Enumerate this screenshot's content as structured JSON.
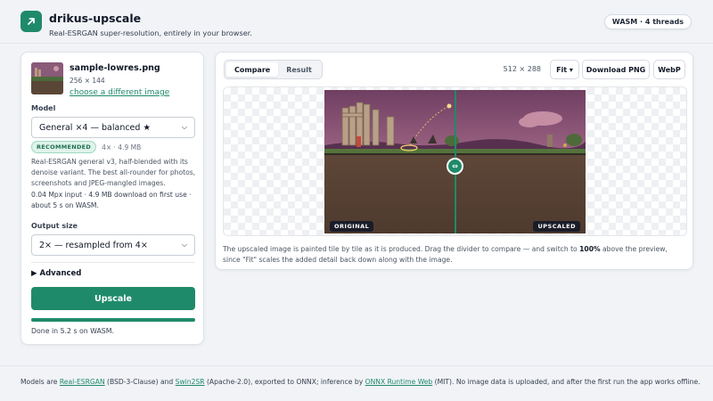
{
  "header": {
    "title": "drikus-upscale",
    "subtitle": "Real-ESRGAN super-resolution, entirely in your browser.",
    "runtime_badge": "WASM · 4 threads",
    "logo_icon": "arrow-up-right-icon",
    "brand_color": "#1f8a6a"
  },
  "input": {
    "file_name": "sample-lowres.png",
    "dimensions": "256 × 144",
    "change_link": "choose a different image"
  },
  "model": {
    "label": "Model",
    "selected": "General ×4 — balanced ★",
    "badge": "RECOMMENDED",
    "meta": "4× · 4.9 MB",
    "description": "Real-ESRGAN general v3, half-blended with its denoise variant. The best all-rounder for photos, screenshots and JPEG-mangled images.",
    "stats": "0.04 Mpx input · 4.9 MB download on first use · about 5 s on WASM."
  },
  "output": {
    "label": "Output size",
    "selected": "2× — resampled from 4×"
  },
  "advanced_label": "Advanced",
  "upscale_button": "Upscale",
  "progress": 1.0,
  "status": "Done in 5.2 s on WASM.",
  "preview": {
    "tabs": [
      {
        "label": "Compare",
        "active": true
      },
      {
        "label": "Result",
        "active": false
      }
    ],
    "output_dims": "512 × 288",
    "zoom_label": "Fit ▾",
    "download_png": "Download PNG",
    "webp": "WebP",
    "left_tag": "ORIGINAL",
    "right_tag": "UPSCALED",
    "handle_glyph": "⇔",
    "note_a": "The upscaled image is painted tile by tile as it is produced. Drag the divider to compare — and switch to ",
    "note_bold": "100%",
    "note_b": " above the preview, since \"Fit\" scales the added detail back down along with the image."
  },
  "footer": {
    "t1": "Models are ",
    "l1": "Real-ESRGAN",
    "t2": " (BSD-3-Clause) and ",
    "l2": "Swin2SR",
    "t3": " (Apache-2.0), exported to ONNX; inference by ",
    "l3": "ONNX Runtime Web",
    "t4": " (MIT). No image data is uploaded, and after the first run the app works offline."
  }
}
